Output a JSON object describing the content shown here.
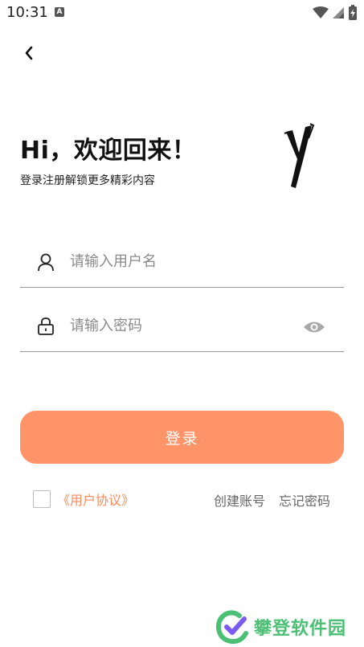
{
  "status_bar": {
    "time": "10:31",
    "notification_icon": "a-letter-icon",
    "wifi_icon": "wifi-icon",
    "signal_icon": "signal-icon",
    "battery_icon": "battery-charging-icon"
  },
  "nav": {
    "back_icon": "chevron-left-icon"
  },
  "header": {
    "greeting": "Hi，欢迎回来！",
    "subtitle": "登录注册解锁更多精彩内容"
  },
  "form": {
    "username": {
      "placeholder": "请输入用户名",
      "value": "",
      "icon": "user-icon"
    },
    "password": {
      "placeholder": "请输入密码",
      "value": "",
      "icon": "lock-icon",
      "toggle_icon": "eye-icon"
    },
    "login_label": "登录"
  },
  "footer": {
    "agreement_checked": false,
    "agreement_label": "《用户协议》",
    "create_account": "创建账号",
    "forgot_password": "忘记密码"
  },
  "watermark": {
    "text": "攀登软件园"
  },
  "colors": {
    "accent": "#ff9468",
    "link": "#ff8a5b",
    "watermark_green": "#4bbf73"
  }
}
